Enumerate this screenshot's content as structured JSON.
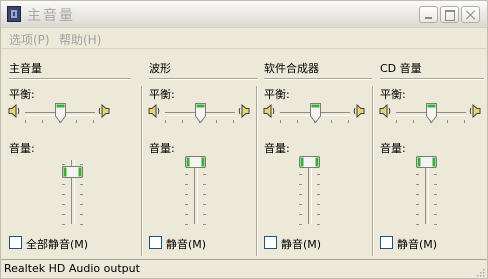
{
  "window": {
    "title": "主音量"
  },
  "menu": {
    "options": "选项(P)",
    "help": "帮助(H)"
  },
  "channels": [
    {
      "name": "主音量",
      "balance_label": "平衡:",
      "volume_label": "音量:",
      "mute_label": "全部静音(M)",
      "balance": 0.5,
      "volume": 0.85,
      "muted": false
    },
    {
      "name": "波形",
      "balance_label": "平衡:",
      "volume_label": "音量:",
      "mute_label": "静音(M)",
      "balance": 0.5,
      "volume": 1.0,
      "muted": false
    },
    {
      "name": "软件合成器",
      "balance_label": "平衡:",
      "volume_label": "音量:",
      "mute_label": "静音(M)",
      "balance": 0.5,
      "volume": 1.0,
      "muted": false
    },
    {
      "name": "CD 音量",
      "balance_label": "平衡:",
      "volume_label": "音量:",
      "mute_label": "静音(M)",
      "balance": 0.5,
      "volume": 1.0,
      "muted": false
    }
  ],
  "status": {
    "text": "Realtek HD Audio output"
  },
  "colors": {
    "thumb_accent": "#36b336",
    "speaker_fill": "#e6d56e"
  }
}
